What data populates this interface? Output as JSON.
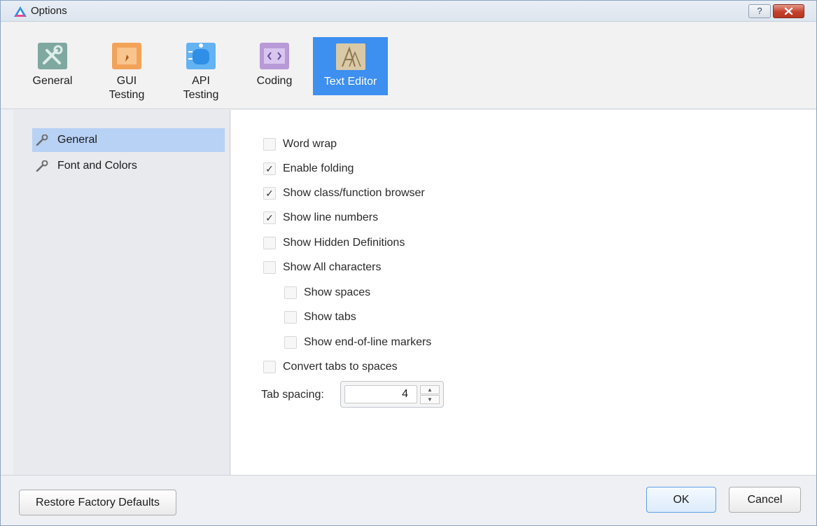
{
  "window": {
    "title": "Options",
    "help_label": "?"
  },
  "toolbar": {
    "items": [
      {
        "label": "General",
        "icon": "tools-icon",
        "active": false
      },
      {
        "label": "GUI\nTesting",
        "icon": "gui-testing-icon",
        "active": false
      },
      {
        "label": "API\nTesting",
        "icon": "api-testing-icon",
        "active": false
      },
      {
        "label": "Coding",
        "icon": "code-window-icon",
        "active": false
      },
      {
        "label": "Text Editor",
        "icon": "text-editor-icon",
        "active": true
      }
    ]
  },
  "sidebar": {
    "items": [
      {
        "label": "General",
        "icon": "wrench-icon",
        "selected": true
      },
      {
        "label": "Font and Colors",
        "icon": "wrench-icon",
        "selected": false
      }
    ]
  },
  "options": [
    {
      "label": "Word wrap",
      "checked": false
    },
    {
      "label": "Enable folding",
      "checked": true
    },
    {
      "label": "Show class/function browser",
      "checked": true
    },
    {
      "label": "Show line numbers",
      "checked": true
    },
    {
      "label": "Show Hidden Definitions",
      "checked": false
    },
    {
      "label": "Show All characters",
      "checked": false
    },
    {
      "label": "Show spaces",
      "checked": false
    },
    {
      "label": "Show tabs",
      "checked": false
    },
    {
      "label": "Show end-of-line markers",
      "checked": false
    },
    {
      "label": "Convert tabs to spaces",
      "checked": false
    }
  ],
  "tab_spacing": {
    "label": "Tab spacing:",
    "value": "4"
  },
  "footer": {
    "restore_label": "Restore Factory Defaults",
    "ok_label": "OK",
    "cancel_label": "Cancel"
  },
  "colors": {
    "accent": "#3d8ff0",
    "selection": "#b8d2f5",
    "close": "#c4402c"
  }
}
